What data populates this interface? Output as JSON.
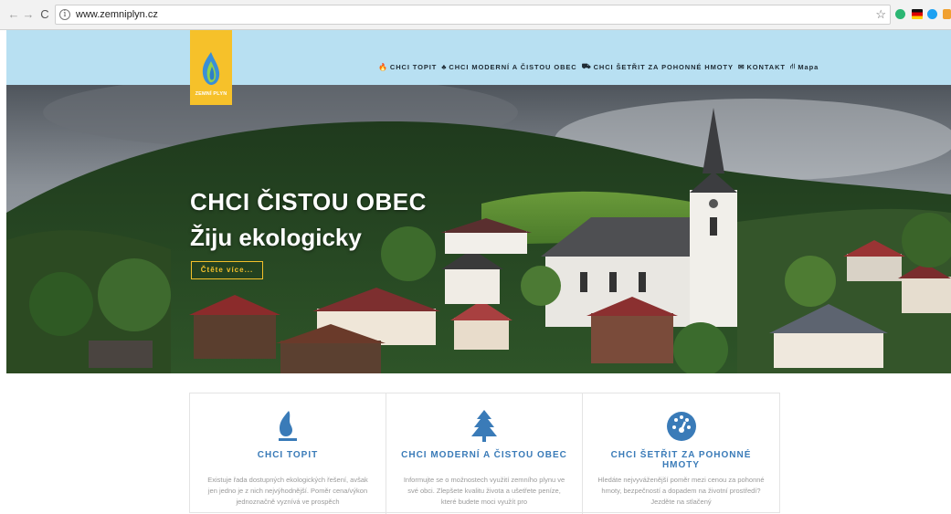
{
  "browser": {
    "url": "www.zemniplyn.cz",
    "back_icon": "arrow-left",
    "forward_icon": "arrow-right",
    "reload_icon": "reload"
  },
  "header": {
    "logo_text": "ZEMNÍ PLYN",
    "menu": [
      {
        "icon": "flame",
        "label": "CHCI TOPIT"
      },
      {
        "icon": "tree",
        "label": "CHCI MODERNÍ A ČISTOU OBEC"
      },
      {
        "icon": "car",
        "label": "CHCI ŠETŘIT ZA POHONNÉ HMOTY"
      },
      {
        "icon": "envelope",
        "label": "KONTAKT"
      },
      {
        "icon": "sitemap",
        "label": "Mapa"
      }
    ],
    "colors": {
      "header_bg": "#b8e0f2",
      "logo_bg": "#f6c12a",
      "accent": "#3a7bb8"
    }
  },
  "hero": {
    "title": "CHCI ČISTOU OBEC",
    "subtitle": "Žiju ekologicky",
    "button": "Čtěte více..."
  },
  "cards": [
    {
      "icon": "flame-icon",
      "title": "CHCI TOPIT",
      "text": "Existuje řada dostupných ekologických řešení, avšak jen jedno je z nich nejvýhodnější. Poměr cena/výkon jednoznačně vyznívá ve prospěch"
    },
    {
      "icon": "tree-icon",
      "title": "CHCI MODERNÍ A ČISTOU OBEC",
      "text": "Informujte se o možnostech využití zemního plynu ve své obci. Zlepšete kvalitu života a ušetřete peníze, které budete moci využít pro"
    },
    {
      "icon": "gauge-icon",
      "title": "CHCI ŠETŘIT ZA POHONNÉ HMOTY",
      "text": "Hledáte nejvyváženější poměr mezi cenou za pohonné hmoty, bezpečností a dopadem na životní prostředí? Jezděte na stlačený"
    }
  ]
}
